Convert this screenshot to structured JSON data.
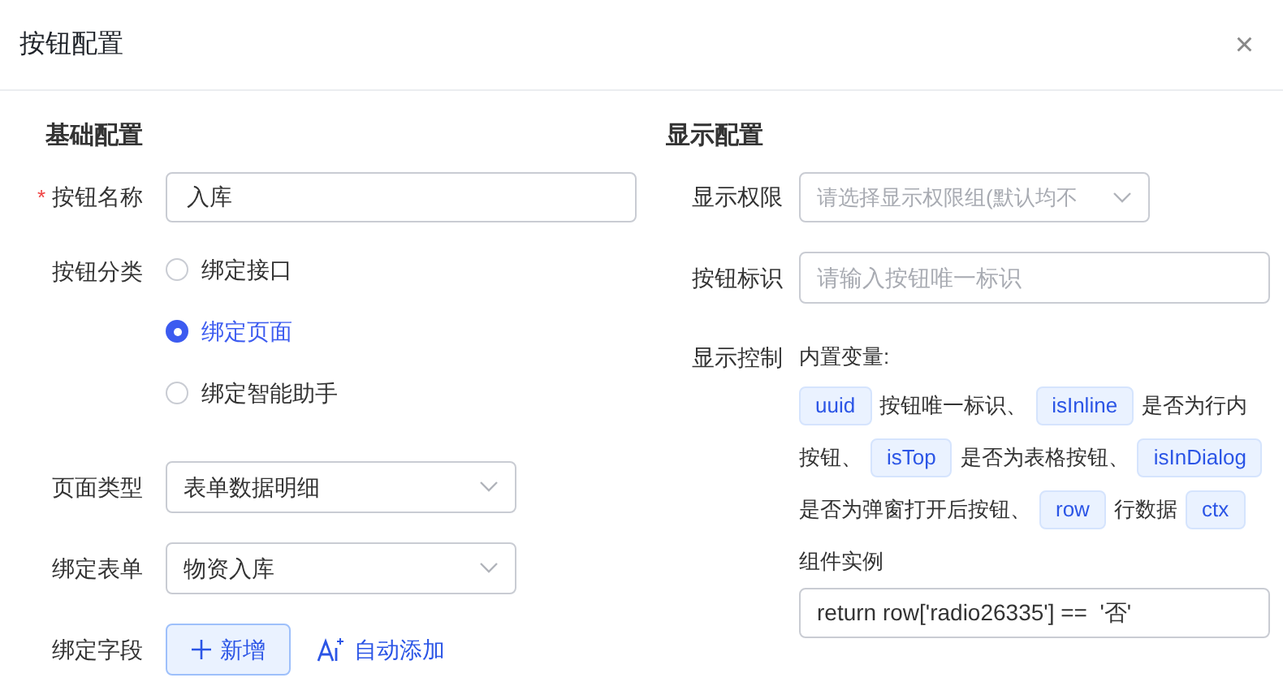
{
  "dialog": {
    "title": "按钮配置",
    "close": "×"
  },
  "basic": {
    "heading": "基础配置",
    "name": {
      "label": "按钮名称",
      "required_mark": "*",
      "value": "入库"
    },
    "category": {
      "label": "按钮分类",
      "options": [
        {
          "label": "绑定接口",
          "selected": false
        },
        {
          "label": "绑定页面",
          "selected": true
        },
        {
          "label": "绑定智能助手",
          "selected": false
        }
      ]
    },
    "page_type": {
      "label": "页面类型",
      "value": "表单数据明细"
    },
    "bind_form": {
      "label": "绑定表单",
      "value": "物资入库"
    },
    "bind_field": {
      "label": "绑定字段",
      "add_button": "新增",
      "auto_link": "自动添加"
    }
  },
  "display": {
    "heading": "显示配置",
    "permission": {
      "label": "显示权限",
      "placeholder": "请选择显示权限组(默认均不"
    },
    "identifier": {
      "label": "按钮标识",
      "placeholder": "请输入按钮唯一标识"
    },
    "control": {
      "label": "显示控制",
      "intro": "内置变量:",
      "lines": [
        [
          {
            "kind": "tag",
            "text": "uuid"
          },
          {
            "kind": "text",
            "text": "按钮唯一标识、"
          },
          {
            "kind": "tag",
            "text": "isInline"
          },
          {
            "kind": "text",
            "text": "是否为行内"
          }
        ],
        [
          {
            "kind": "text",
            "text": "按钮、"
          },
          {
            "kind": "tag",
            "text": "isTop"
          },
          {
            "kind": "text",
            "text": "是否为表格按钮、"
          },
          {
            "kind": "tag",
            "text": "isInDialog"
          }
        ],
        [
          {
            "kind": "text",
            "text": "是否为弹窗打开后按钮、"
          },
          {
            "kind": "tag",
            "text": "row"
          },
          {
            "kind": "text",
            "text": "行数据"
          },
          {
            "kind": "tag",
            "text": "ctx"
          }
        ],
        [
          {
            "kind": "text",
            "text": "组件实例"
          }
        ]
      ],
      "code": "return row['radio26335'] ==  '否'"
    }
  }
}
